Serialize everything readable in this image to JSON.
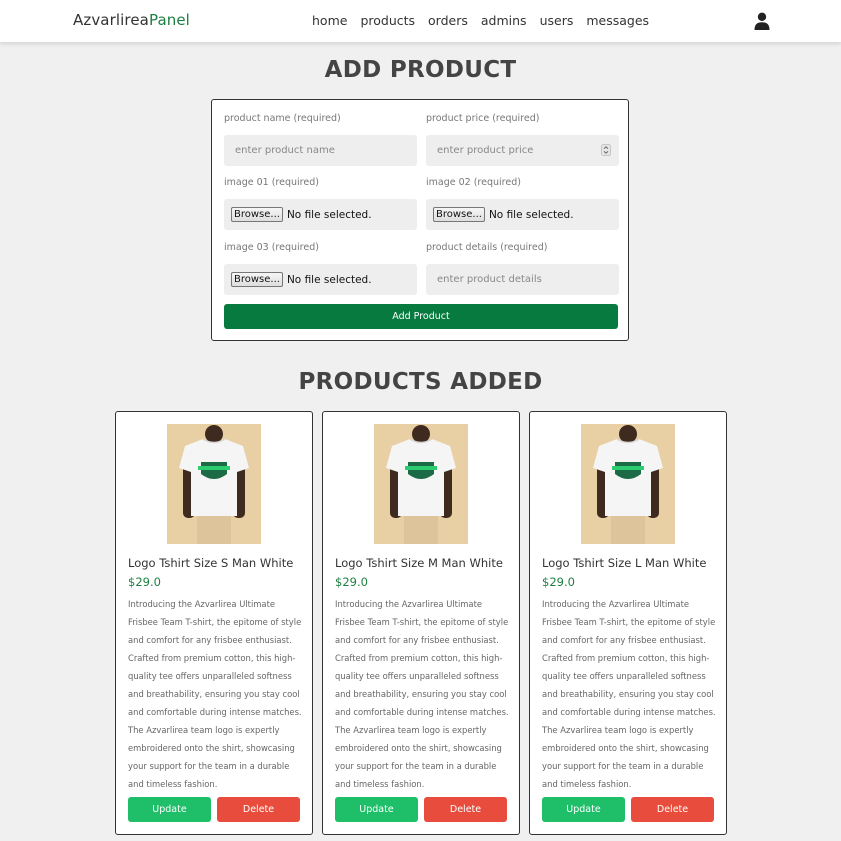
{
  "header": {
    "logo_main": "Azvarlirea",
    "logo_accent": "Panel",
    "nav": [
      "home",
      "products",
      "orders",
      "admins",
      "users",
      "messages"
    ]
  },
  "add_section": {
    "title": "ADD PRODUCT",
    "fields": {
      "name_label": "product name (required)",
      "name_placeholder": "enter product name",
      "price_label": "product price (required)",
      "price_placeholder": "enter product price",
      "image1_label": "image 01 (required)",
      "image2_label": "image 02 (required)",
      "image3_label": "image 03 (required)",
      "details_label": "product details (required)",
      "details_placeholder": "enter product details",
      "browse_label": "Browse...",
      "no_file": "No file selected."
    },
    "submit_label": "Add Product"
  },
  "products_section": {
    "title": "PRODUCTS ADDED",
    "update_label": "Update",
    "delete_label": "Delete",
    "products": [
      {
        "name": "Logo Tshirt Size S Man White",
        "price": "$29.0",
        "description": "Introducing the Azvarlirea Ultimate Frisbee Team T-shirt, the epitome of style and comfort for any frisbee enthusiast. Crafted from premium cotton, this high-quality tee offers unparalleled softness and breathability, ensuring you stay cool and comfortable during intense matches. The Azvarlirea team logo is expertly embroidered onto the shirt, showcasing your support for the team in a durable and timeless fashion."
      },
      {
        "name": "Logo Tshirt Size M Man White",
        "price": "$29.0",
        "description": "Introducing the Azvarlirea Ultimate Frisbee Team T-shirt, the epitome of style and comfort for any frisbee enthusiast. Crafted from premium cotton, this high-quality tee offers unparalleled softness and breathability, ensuring you stay cool and comfortable during intense matches. The Azvarlirea team logo is expertly embroidered onto the shirt, showcasing your support for the team in a durable and timeless fashion."
      },
      {
        "name": "Logo Tshirt Size L Man White",
        "price": "$29.0",
        "description": "Introducing the Azvarlirea Ultimate Frisbee Team T-shirt, the epitome of style and comfort for any frisbee enthusiast. Crafted from premium cotton, this high-quality tee offers unparalleled softness and breathability, ensuring you stay cool and comfortable during intense matches. The Azvarlirea team logo is expertly embroidered onto the shirt, showcasing your support for the team in a durable and timeless fashion."
      }
    ]
  },
  "colors": {
    "accent_green": "#1e7f43",
    "add_button": "#077a3f",
    "update_button": "#1fbf6a",
    "delete_button": "#e74c3c"
  },
  "icons": {
    "user": "user-icon",
    "number_spinner": "spinner-icon"
  }
}
